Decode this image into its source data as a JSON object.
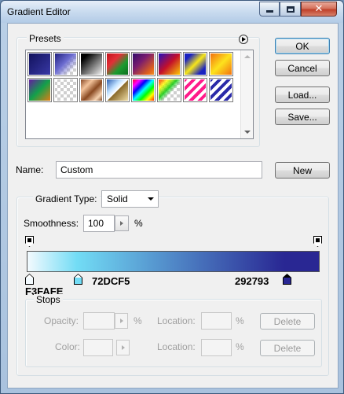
{
  "window": {
    "title": "Gradient Editor"
  },
  "titlebar_buttons": [
    "minimize",
    "maximize",
    "close"
  ],
  "presets": {
    "label": "Presets",
    "menu_icon": "flyout-arrow-icon",
    "swatches": [
      {
        "name": "foreground-to-background",
        "css": "linear-gradient(135deg,#10105a,#3a3aa8)"
      },
      {
        "name": "foreground-to-transparent",
        "css": "linear-gradient(135deg,#1b1b7a,#6c6cd0 45%,rgba(255,255,255,0) 80%), repeating-conic-gradient(#cfcfcf 0 25%,#ffffff 0 50%) 0 0/8px 8px"
      },
      {
        "name": "black-white",
        "css": "linear-gradient(135deg,#000 0%,#000 20%,#fff 100%)"
      },
      {
        "name": "red-green",
        "css": "linear-gradient(135deg,#c0101a,#e23037 35%,#1a9b2e 65%,#0c6a1e)"
      },
      {
        "name": "violet-orange",
        "css": "linear-gradient(135deg,#2a0a6a,#7a1c6e 40%,#e0621b 80%,#f59a2a)"
      },
      {
        "name": "blue-red-yellow",
        "css": "linear-gradient(135deg,#1a10c8,#c4102a 50%,#ffd600)"
      },
      {
        "name": "blue-yellow-blue",
        "css": "linear-gradient(135deg,#1a22c0 0%,#1a22c0 20%,#f7e61a 50%,#1a22c0 80%)"
      },
      {
        "name": "orange-yellow-orange",
        "css": "linear-gradient(135deg,#f26a0f,#fde21d 50%,#f26a0f)"
      },
      {
        "name": "violet-green-orange",
        "css": "linear-gradient(135deg,#6a12a8,#12a04a 50%,#f07a12)"
      },
      {
        "name": "yellow-violet-orange-blue",
        "css": "repeating-conic-gradient(#cfcfcf 0 25%,#ffffff 0 50%) 0 0/8px 8px"
      },
      {
        "name": "copper",
        "css": "linear-gradient(135deg,#7a3a18,#f2c29a 30%,#8a4a22 55%,#f6d2b0 80%,#6a3010)"
      },
      {
        "name": "chrome",
        "css": "linear-gradient(135deg,#1a4fa8 0%,#bfe0ff 35%,#ffffff 50%,#8a6a2a 52%,#f6e6b0 100%)"
      },
      {
        "name": "spectrum",
        "css": "linear-gradient(135deg,#ff0000,#ff00ff 20%,#0000ff 35%,#00ffff 50%,#00ff00 65%,#ffff00 80%,#ff0000)"
      },
      {
        "name": "transparent-rainbow",
        "css": "linear-gradient(135deg,rgba(255,0,0,0.9),rgba(255,255,0,0.8) 25%,rgba(0,200,0,0.8) 45%,rgba(255,255,255,0) 60%), repeating-conic-gradient(#cfcfcf 0 25%,#ffffff 0 50%) 0 0/8px 8px"
      },
      {
        "name": "transparent-stripes-pink",
        "css": "repeating-linear-gradient(135deg,#ff1a8a 0 4px,#ffffff 4px 8px)"
      },
      {
        "name": "transparent-stripes-blue",
        "css": "repeating-linear-gradient(135deg,#2a2aa8 0 4px,#ffffff 4px 8px)"
      }
    ]
  },
  "buttons": {
    "ok": "OK",
    "cancel": "Cancel",
    "load": "Load...",
    "save": "Save...",
    "new": "New",
    "delete": "Delete"
  },
  "name": {
    "label": "Name:",
    "value": "Custom"
  },
  "gradient": {
    "type_label": "Gradient Type:",
    "type_value": "Solid",
    "smoothness_label": "Smoothness:",
    "smoothness_value": "100",
    "percent": "%",
    "bar_css": "linear-gradient(90deg,#F3FAFE 0%,#72DCF5 17%,#292793 88%,#292793 100%)",
    "color_stops": [
      {
        "hex": "F3FAFE",
        "color": "#F3FAFE",
        "location": 0
      },
      {
        "hex": "72DCF5",
        "color": "#72DCF5",
        "location": 17
      },
      {
        "hex": "292793",
        "color": "#292793",
        "location": 88
      }
    ]
  },
  "stops": {
    "label": "Stops",
    "opacity_label": "Opacity:",
    "color_label": "Color:",
    "location_label": "Location:",
    "percent": "%"
  }
}
